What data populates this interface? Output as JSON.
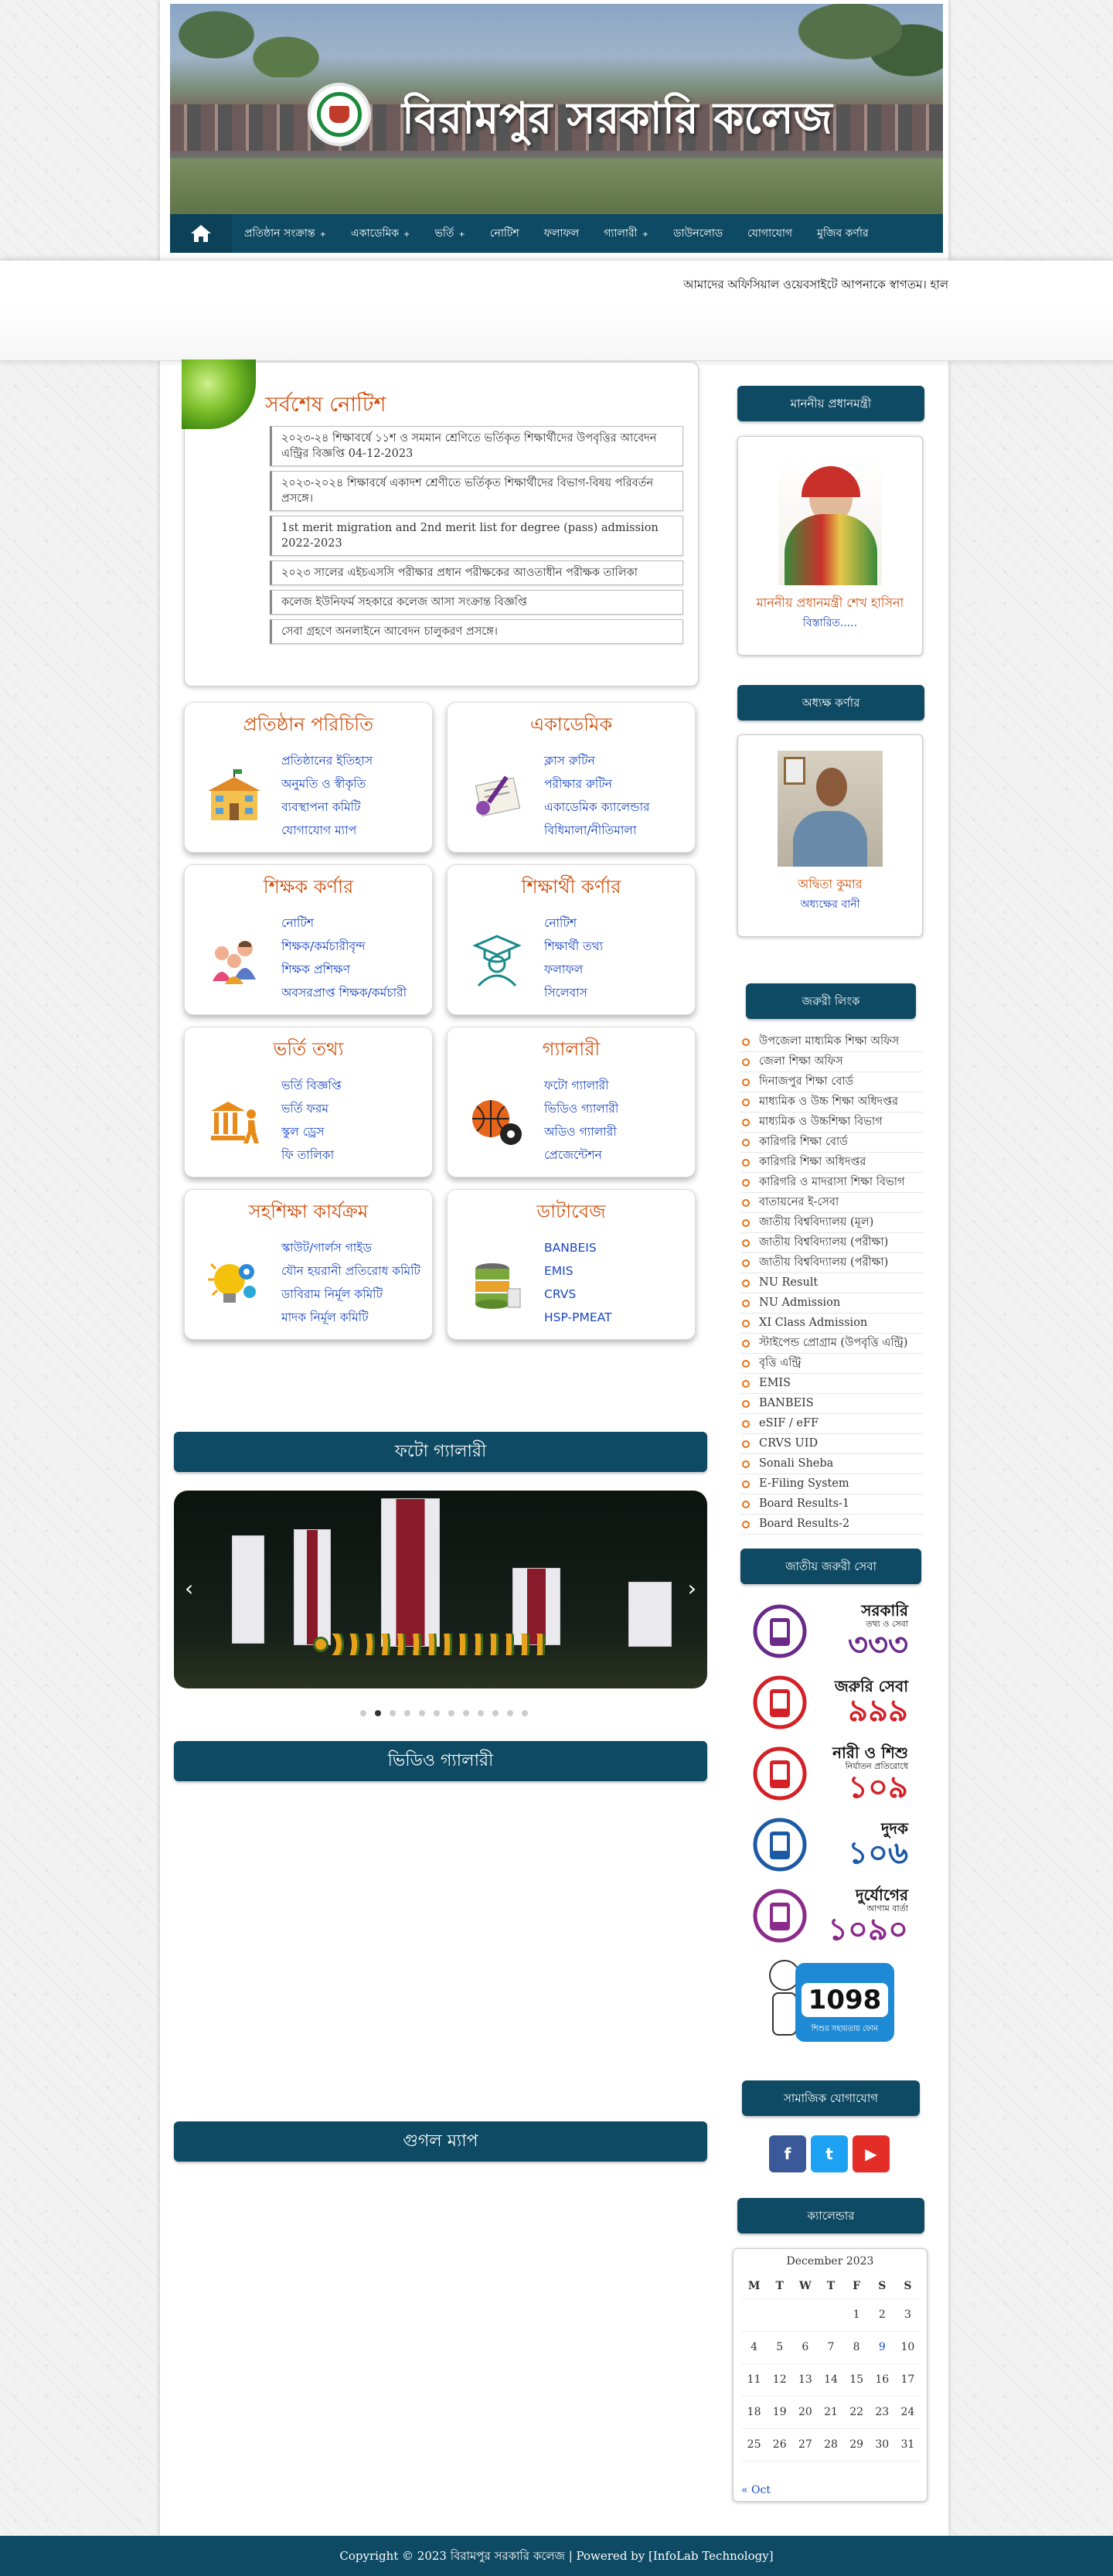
{
  "site": {
    "name": "বিরামপুর সরকারি কলেজ"
  },
  "nav": {
    "items": [
      "প্রতিষ্ঠান সংক্রান্ত",
      "একাডেমিক",
      "ভর্তি",
      "নোটিশ",
      "ফলাফল",
      "গ্যালারী",
      "ডাউনলোড",
      "যোগাযোগ",
      "মুজিব কর্ণার"
    ],
    "dropdown_marker": "+"
  },
  "marquee": "আমাদের অফিসিয়াল ওয়েবসাইটে আপনাকে স্বাগতম। হাল",
  "notice": {
    "title": "সর্বশেষ নোটিশ",
    "items": [
      "২০২৩-২৪ শিক্ষাবর্ষে ১১শ ও সমমান শ্রেণিতে ভর্তিকৃত শিক্ষার্থীদের উপবৃত্তির আবেদন এন্ট্রির বিজ্ঞপ্তি 04-12-2023",
      "২০২৩-২০২৪ শিক্ষাবর্ষে একাদশ শ্রেণীতে ভর্তিকৃত শিক্ষার্থীদের বিভাগ-বিষয় পরিবর্তন প্রসঙ্গে।",
      "1st merit migration and 2nd merit list for degree (pass) admission 2022-2023",
      "২০২৩ সালের এইচএসসি পরীক্ষার প্রধান পরীক্ষকের আওতাধীন পরীক্ষক তালিকা",
      "কলেজ ইউনিফর্ম সহকারে কলেজ আসা সংক্রান্ত বিজ্ঞপ্তি",
      "সেবা গ্রহণে অনলাইনে আবেদন চালুকরণ প্রসঙ্গে।"
    ]
  },
  "cards": [
    {
      "title": "প্রতিষ্ঠান পরিচিতি",
      "icon": "school-building-icon",
      "links": [
        "প্রতিষ্ঠানের ইতিহাস",
        "অনুমতি ও স্বীকৃতি",
        "ব্যবস্থাপনা কমিটি",
        "যোগাযোগ ম্যাপ"
      ]
    },
    {
      "title": "একাডেমিক",
      "icon": "certificate-icon",
      "links": [
        "ক্লাস রুটিন",
        "পরীক্ষার রুটিন",
        "একাডেমিক ক্যালেন্ডার",
        "বিধিমালা/নীতিমালা"
      ]
    },
    {
      "title": "শিক্ষক কর্ণার",
      "icon": "teachers-icon",
      "links": [
        "নোটিশ",
        "শিক্ষক/কর্মচারীবৃন্দ",
        "শিক্ষক প্রশিক্ষণ",
        "অবসরপ্রাপ্ত শিক্ষক/কর্মচারী"
      ]
    },
    {
      "title": "শিক্ষার্থী কর্ণার",
      "icon": "graduate-icon",
      "links": [
        "নোটিশ",
        "শিক্ষার্থী তথ্য",
        "ফলাফল",
        "সিলেবাস"
      ]
    },
    {
      "title": "ভর্তি তথ্য",
      "icon": "admission-icon",
      "links": [
        "ভর্তি বিজ্ঞপ্তি",
        "ভর্তি ফরম",
        "স্কুল ড্রেস",
        "ফি তালিকা"
      ]
    },
    {
      "title": "গ্যালারী",
      "icon": "sports-ball-icon",
      "links": [
        "ফটো গ্যালারী",
        "ভিডিও গ্যালারী",
        "অডিও গ্যালারী",
        "প্রেজেন্টেশন"
      ]
    },
    {
      "title": "সহশিক্ষা কার্যক্রম",
      "icon": "idea-gear-icon",
      "links": [
        "স্কাউট/গার্লস গাইড",
        "যৌন হয়রানী প্রতিরোধ কমিটি",
        "ডাবিরাম নির্মূল কমিটি",
        "মাদক নির্মূল কমিটি"
      ]
    },
    {
      "title": "ডাটাবেজ",
      "icon": "database-icon",
      "links": [
        "BANBEIS",
        "EMIS",
        "CRVS",
        "HSP-PMEAT"
      ]
    }
  ],
  "sections": {
    "photo_gallery": "ফটো গ্যালারী",
    "video_gallery": "ভিডিও গ্যালারী",
    "google_map": "গুগল ম্যাপ"
  },
  "gallery": {
    "slides": 12,
    "active": 2,
    "prev": "‹",
    "next": "›"
  },
  "sidebar": {
    "pm": {
      "heading": "মাননীয় প্রধানমন্ত্রী",
      "name": "মাননীয় প্রধানমন্ত্রী শেখ হাসিনা",
      "more": "বিস্তারিত....."
    },
    "principal": {
      "heading": "অধ্যক্ষ কর্ণার",
      "name": "অদ্বিতা কুমার",
      "more": "অধ্যক্ষের বানী"
    },
    "links_heading": "জরুরী লিংক",
    "links": [
      "উপজেলা মাধ্যমিক শিক্ষা অফিস",
      "জেলা শিক্ষা অফিস",
      "দিনাজপুর শিক্ষা বোর্ড",
      "মাধ্যমিক ও উচ্চ শিক্ষা অধিদপ্তর",
      "মাধ্যমিক ও উচ্চশিক্ষা বিভাগ",
      "কারিগরি শিক্ষা বোর্ড",
      "কারিগরি শিক্ষা অধিদপ্তর",
      "কারিগরি ও মাদরাসা শিক্ষা বিভাগ",
      "বাতায়নের ই-সেবা",
      "জাতীয় বিশ্ববিদ্যালয় (মূল)",
      "জাতীয় বিশ্ববিদ্যালয় (পরীক্ষা)",
      "জাতীয় বিশ্ববিদ্যালয় (পরীক্ষা)",
      "NU Result",
      "NU Admission",
      "XI Class Admission",
      "স্টাইপেন্ড প্রোগ্রাম (উপবৃত্তি এন্ট্রি)",
      "বৃত্তি এন্ট্রি",
      "EMIS",
      "BANBEIS",
      "eSIF / eFF",
      "CRVS UID",
      "Sonali Sheba",
      "E-Filing System",
      "Board Results-1",
      "Board Results-2"
    ],
    "hotline_heading": "জাতীয় জরুরী সেবা",
    "hotlines": [
      {
        "label": "সরকারি",
        "sub": "তথ্য ও সেবা",
        "num": "৩৩৩",
        "color": "#6a2a8a",
        "icon": "phone-333-icon"
      },
      {
        "label": "জরুরি সেবা",
        "sub": "",
        "num": "৯৯৯",
        "color": "#d42027",
        "icon": "mobile-999-icon"
      },
      {
        "label": "নারী ও শিশু",
        "sub": "নির্যাতন প্রতিরোধে",
        "num": "১০৯",
        "color": "#d42027",
        "icon": "helpline-109-icon"
      },
      {
        "label": "দুদক",
        "sub": "",
        "num": "১০৬",
        "color": "#1d5aa6",
        "icon": "acc-106-icon"
      },
      {
        "label": "দুর্যোগের",
        "sub": "আগাম বার্তা",
        "num": "১০৯০",
        "color": "#8a2a8a",
        "icon": "disaster-1090-icon"
      }
    ],
    "child_line": {
      "num": "1098",
      "sub": "শিশুর সহায়তায় ফোন"
    },
    "social_heading": "সামাজিক যোগাযোগ",
    "social": [
      {
        "name": "facebook",
        "glyph": "f",
        "color": "#3b5998"
      },
      {
        "name": "twitter",
        "glyph": "t",
        "color": "#1da1f2"
      },
      {
        "name": "youtube",
        "glyph": "▶",
        "color": "#e52d27"
      }
    ],
    "calendar_heading": "ক্যালেন্ডার"
  },
  "calendar": {
    "month": "December 2023",
    "days": [
      "M",
      "T",
      "W",
      "T",
      "F",
      "S",
      "S"
    ],
    "weeks": [
      [
        "",
        "",
        "",
        "",
        "1",
        "2",
        "3"
      ],
      [
        "4",
        "5",
        "6",
        "7",
        "8",
        "9",
        "10"
      ],
      [
        "11",
        "12",
        "13",
        "14",
        "15",
        "16",
        "17"
      ],
      [
        "18",
        "19",
        "20",
        "21",
        "22",
        "23",
        "24"
      ],
      [
        "25",
        "26",
        "27",
        "28",
        "29",
        "30",
        "31"
      ]
    ],
    "today": "9",
    "prev": "« Oct"
  },
  "footer": "Copyright © 2023 বিরামপুর সরকারি কলেজ | Powered by [InfoLab Technology]"
}
